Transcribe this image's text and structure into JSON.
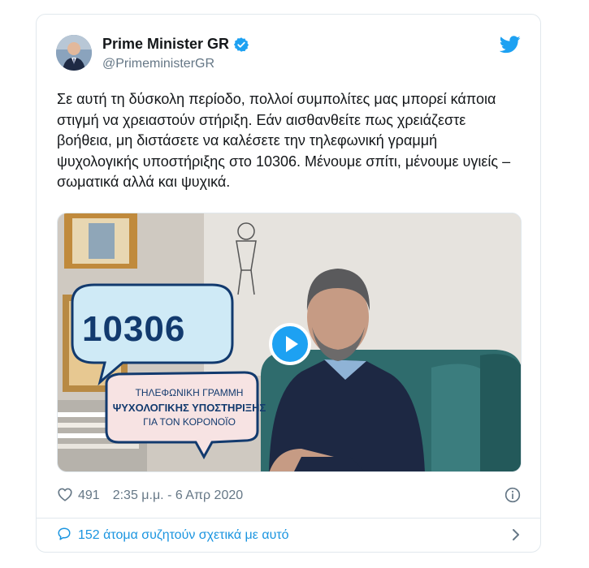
{
  "author": {
    "name": "Prime Minister GR",
    "handle": "@PrimeministerGR"
  },
  "tweet": {
    "text": "Σε αυτή τη δύσκολη περίοδο, πολλοί συμπολίτες μας μπορεί κάποια στιγμή να χρειαστούν στήριξη. Εάν αισθανθείτε πως χρειάζεστε βοήθεια, μη διστάσετε να καλέσετε την τηλεφωνική γραμμή ψυχολογικής υποστήριξης στο 10306. Μένουμε σπίτι, μένουμε υγιείς – σωματικά αλλά και ψυχικά."
  },
  "video": {
    "overlay_number": "10306",
    "overlay_line1": "ΤΗΛΕΦΩΝΙΚΗ ΓΡΑΜΜΗ",
    "overlay_line2": "ΨΥΧΟΛΟΓΙΚΗΣ ΥΠΟΣΤΗΡΙΞΗΣ",
    "overlay_line3": "ΓΙΑ ΤΟΝ ΚΟΡΟΝΟΪΟ"
  },
  "meta": {
    "likes": "491",
    "timestamp": "2:35 μ.μ. - 6 Απρ 2020"
  },
  "discussion": {
    "label": "152 άτομα συζητούν σχετικά με αυτό"
  },
  "colors": {
    "accent": "#1da1f2",
    "link": "#1b95e0",
    "secondary_text": "#657786",
    "border": "#e1e8ed"
  },
  "icons": [
    "verified-badge-icon",
    "twitter-bird-icon",
    "heart-icon",
    "info-icon",
    "comment-bubble-icon",
    "chevron-right-icon",
    "play-icon"
  ]
}
